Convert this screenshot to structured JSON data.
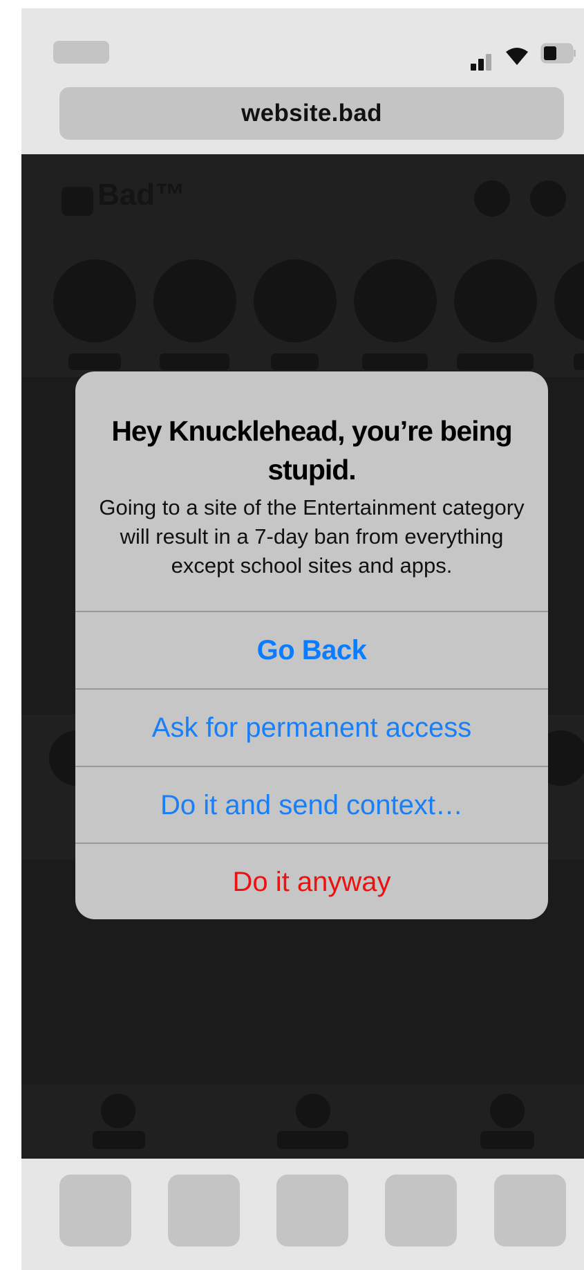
{
  "browser": {
    "address": "website.bad",
    "status_icons": [
      "cellular-signal-icon",
      "wifi-icon",
      "battery-icon"
    ]
  },
  "website": {
    "logo_text": "Bad™"
  },
  "alert": {
    "title": "Hey Knucklehead, you’re being stupid.",
    "message": "Going to a site of the Entertainment category will result in a 7-day ban from everything except school sites and apps.",
    "buttons": {
      "go_back": "Go Back",
      "permanent_access": "Ask for permanent access",
      "send_context": "Do it and send context…",
      "anyway": "Do it anyway"
    }
  },
  "colors": {
    "accent_blue": "#0a7cff",
    "destructive_red": "#ee1111",
    "alert_background": "#c6c6c6",
    "page_dark": "#1b1b1b"
  }
}
